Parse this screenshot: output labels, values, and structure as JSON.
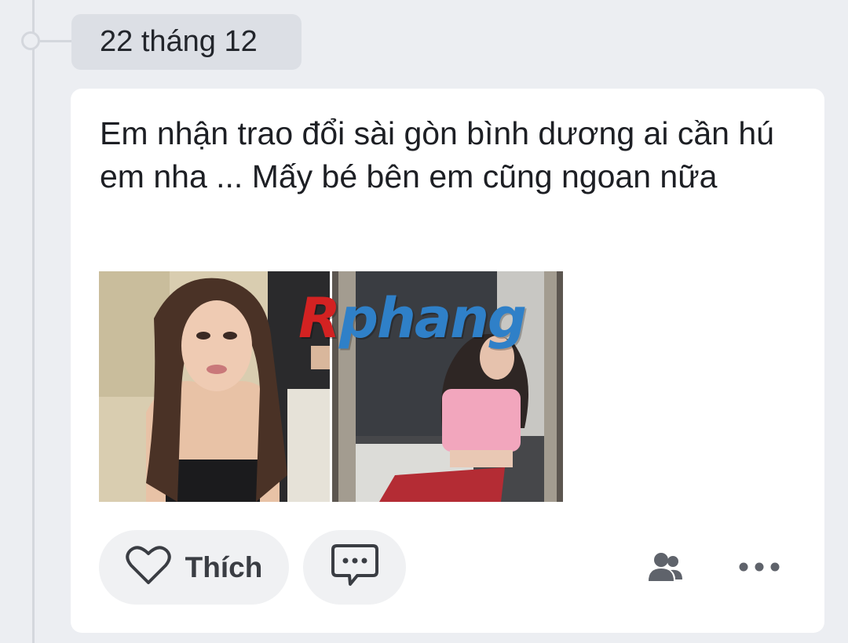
{
  "timeline": {
    "date_label": "22 tháng 12"
  },
  "post": {
    "text": "Em nhận trao đổi sài gòn bình dương ai cần hú em nha ... Mấy bé bên em cũng ngoan nữa",
    "watermark": {
      "first": "R",
      "rest": "phang"
    },
    "images": [
      {
        "name": "photo-woman-portrait",
        "icon": "photo"
      },
      {
        "name": "photo-mirror-selfie",
        "icon": "photo"
      }
    ]
  },
  "actions": {
    "like_label": "Thích",
    "like_icon": "heart-outline-icon",
    "comment_icon": "comment-bubble-icon",
    "audience_icon": "friends-icon",
    "more_icon": "more-horizontal-icon"
  },
  "colors": {
    "background": "#eceef2",
    "card": "#ffffff",
    "date_pill": "#dcdfe5",
    "action_pill": "#f0f1f3",
    "watermark_red": "#d32222",
    "watermark_blue": "#2f80c8"
  }
}
